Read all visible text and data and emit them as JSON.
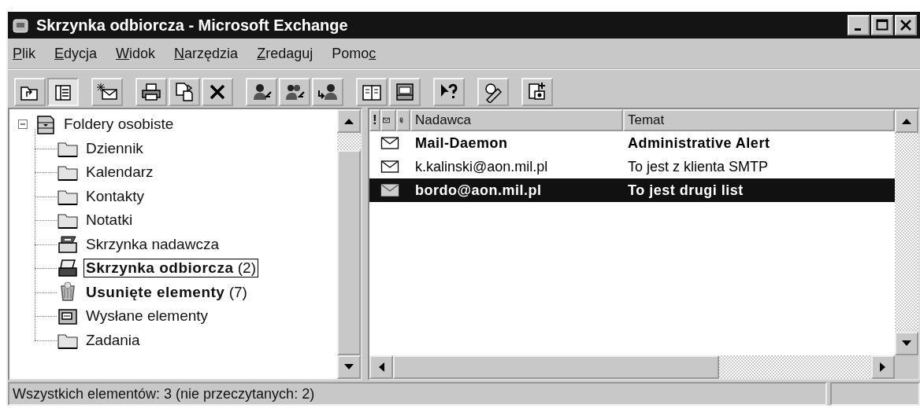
{
  "window": {
    "title": "Skrzynka odbiorcza - Microsoft Exchange"
  },
  "menu": [
    {
      "key": "P",
      "after": "lik"
    },
    {
      "key": "E",
      "after": "dycja"
    },
    {
      "key": "W",
      "after": "idok"
    },
    {
      "key": "N",
      "after": "arzędzia"
    },
    {
      "key": "Z",
      "after": "redaguj"
    },
    {
      "before": "Pomo",
      "key": "c"
    }
  ],
  "toolbar": [
    {
      "kind": "up",
      "pressed": false
    },
    {
      "kind": "list",
      "pressed": true
    },
    {
      "kind": "sep"
    },
    {
      "kind": "new",
      "pressed": false
    },
    {
      "kind": "sep"
    },
    {
      "kind": "print",
      "pressed": false
    },
    {
      "kind": "move",
      "pressed": false
    },
    {
      "kind": "delete",
      "pressed": false
    },
    {
      "kind": "sep"
    },
    {
      "kind": "reply",
      "pressed": false
    },
    {
      "kind": "replyall",
      "pressed": false
    },
    {
      "kind": "forward",
      "pressed": false
    },
    {
      "kind": "sep"
    },
    {
      "kind": "book",
      "pressed": false
    },
    {
      "kind": "inbox",
      "pressed": false
    },
    {
      "kind": "sep"
    },
    {
      "kind": "help",
      "pressed": false
    },
    {
      "kind": "sep"
    },
    {
      "kind": "check",
      "pressed": false
    },
    {
      "kind": "sep"
    },
    {
      "kind": "newitem",
      "pressed": false
    }
  ],
  "folders": {
    "label": "Foldery osobiste",
    "expanded": true,
    "children": [
      {
        "label": "Dziennik",
        "kind": "folder",
        "unread": false,
        "selected": false
      },
      {
        "label": "Kalendarz",
        "kind": "folder",
        "unread": false,
        "selected": false
      },
      {
        "label": "Kontakty",
        "kind": "folder",
        "unread": false,
        "selected": false
      },
      {
        "label": "Notatki",
        "kind": "folder",
        "unread": false,
        "selected": false
      },
      {
        "label": "Skrzynka nadawcza",
        "kind": "outbox",
        "unread": false,
        "selected": false
      },
      {
        "label": "Skrzynka odbiorcza",
        "count": "(2)",
        "kind": "inbox",
        "unread": true,
        "selected": true
      },
      {
        "label": "Usunięte elementy",
        "count": "(7)",
        "kind": "trash",
        "unread": true,
        "selected": false
      },
      {
        "label": "Wysłane elementy",
        "kind": "sent",
        "unread": false,
        "selected": false
      },
      {
        "label": "Zadania",
        "kind": "folder",
        "unread": false,
        "selected": false
      }
    ]
  },
  "messages": {
    "columns": [
      {
        "kind": "text",
        "label": "!"
      },
      {
        "kind": "envelope"
      },
      {
        "kind": "clip"
      },
      {
        "kind": "text",
        "label": "Nadawca"
      },
      {
        "kind": "text",
        "label": "Temat"
      }
    ],
    "rows": [
      {
        "sender": "Mail-Daemon",
        "subject": "Administrative Alert",
        "unread": true,
        "selected": false
      },
      {
        "sender": "k.kalinski@aon.mil.pl",
        "subject": "To jest z klienta SMTP",
        "unread": false,
        "selected": false
      },
      {
        "sender": "bordo@aon.mil.pl",
        "subject": "To jest drugi list",
        "unread": true,
        "selected": true
      }
    ]
  },
  "status_bar": {
    "text": "Wszystkich elementów: 3 (nie przeczytanych: 2)"
  }
}
